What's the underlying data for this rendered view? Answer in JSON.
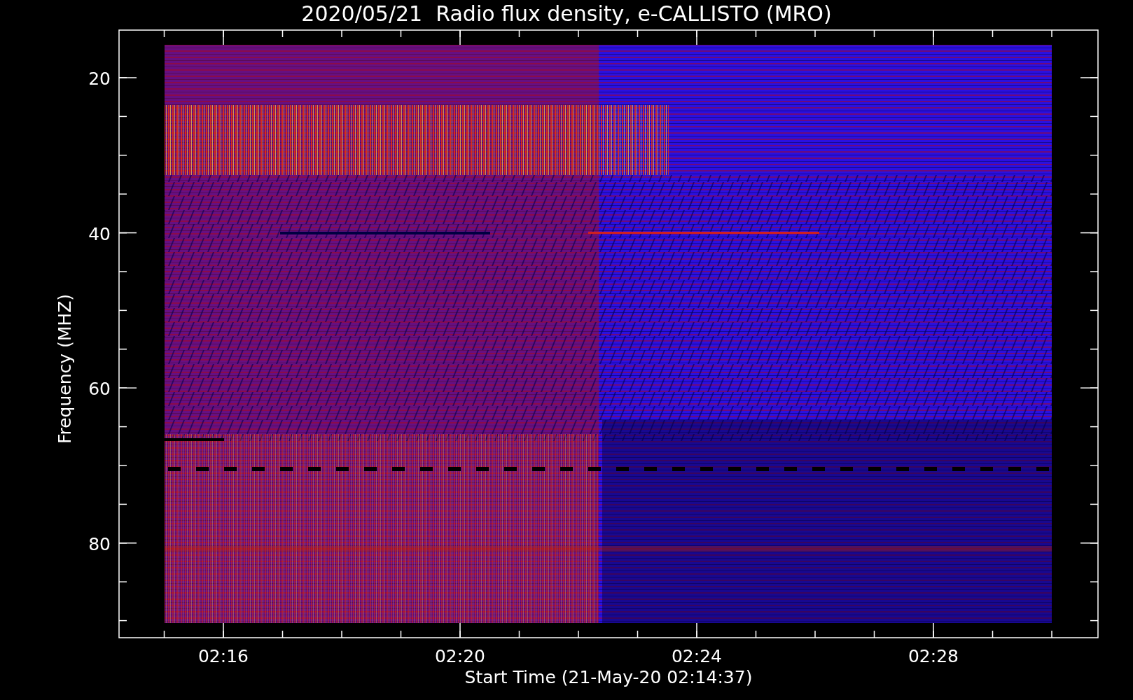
{
  "title": "2020/05/21  Radio flux density, e-CALLISTO (MRO)",
  "xlabel": "Start Time (21-May-20 02:14:37)",
  "ylabel": "Frequency (MHZ)",
  "xtick_labels": [
    "02:16",
    "02:20",
    "02:24",
    "02:28"
  ],
  "ytick_labels": [
    "20",
    "40",
    "60",
    "80"
  ]
}
